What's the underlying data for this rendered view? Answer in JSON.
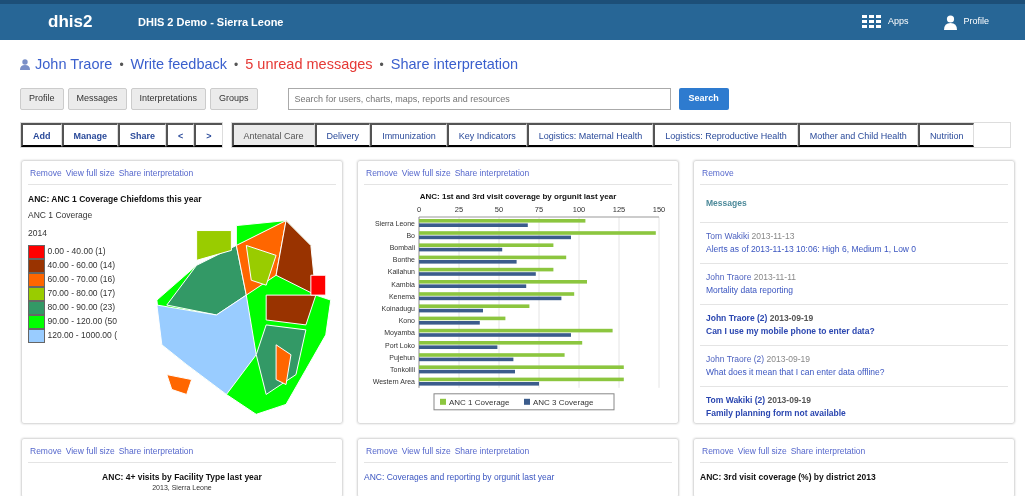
{
  "header": {
    "logo": "dhis2",
    "title": "DHIS 2 Demo - Sierra Leone",
    "apps": "Apps",
    "profile": "Profile"
  },
  "user_line": [
    {
      "text": "John Traore",
      "kind": "user"
    },
    {
      "text": "•",
      "kind": "sep"
    },
    {
      "text": "Write feedback",
      "kind": "link"
    },
    {
      "text": "•",
      "kind": "sep"
    },
    {
      "text": "5 unread messages",
      "kind": "alert"
    },
    {
      "text": "•",
      "kind": "sep"
    },
    {
      "text": "Share interpretation",
      "kind": "link"
    }
  ],
  "nav_buttons": [
    "Profile",
    "Messages",
    "Interpretations",
    "Groups"
  ],
  "search": {
    "placeholder": "Search for users, charts, maps, reports and resources",
    "button": "Search"
  },
  "actions": [
    "Add",
    "Manage",
    "Share",
    "<",
    ">"
  ],
  "dashboards": [
    {
      "label": "Antenatal Care",
      "selected": true
    },
    {
      "label": "Delivery",
      "selected": false
    },
    {
      "label": "Immunization",
      "selected": false
    },
    {
      "label": "Key Indicators",
      "selected": false
    },
    {
      "label": "Logistics: Maternal Health",
      "selected": false
    },
    {
      "label": "Logistics: Reproductive Health",
      "selected": false
    },
    {
      "label": "Mother and Child Health",
      "selected": false
    },
    {
      "label": "Nutrition",
      "selected": false
    }
  ],
  "map_card": {
    "links": [
      "Remove",
      "View full size",
      "Share interpretation"
    ],
    "title": "ANC: ANC 1 Coverage Chiefdoms this year",
    "legend_title": "ANC 1 Coverage",
    "legend_period": "2014",
    "legend": [
      {
        "label": "0.00 - 40.00 (1)",
        "color": "#ff0000"
      },
      {
        "label": "40.00 - 60.00 (14)",
        "color": "#993300"
      },
      {
        "label": "60.00 - 70.00 (16)",
        "color": "#ff6600"
      },
      {
        "label": "70.00 - 80.00 (17)",
        "color": "#99cc00"
      },
      {
        "label": "80.00 - 90.00 (23)",
        "color": "#339966"
      },
      {
        "label": "90.00 - 120.00 (50",
        "color": "#00ff00"
      },
      {
        "label": "120.00 - 1000.00 (",
        "color": "#99ccff"
      }
    ]
  },
  "chart_card": {
    "links": [
      "Remove",
      "View full size",
      "Share interpretation"
    ],
    "chart_data": {
      "type": "bar",
      "orientation": "horizontal",
      "title": "ANC: 1st and 3rd visit coverage by orgunit last year",
      "categories": [
        "Sierra Leone",
        "Bo",
        "Bombali",
        "Bonthe",
        "Kailahun",
        "Kambia",
        "Kenema",
        "Koinadugu",
        "Kono",
        "Moyamba",
        "Port Loko",
        "Pujehun",
        "Tonkolili",
        "Western Area"
      ],
      "xlim": [
        0,
        150
      ],
      "grid": true,
      "legend": true,
      "xticks": [
        0,
        25,
        50,
        75,
        100,
        125,
        150
      ],
      "series": [
        {
          "name": "ANC 1 Coverage",
          "color": "#8cc63f",
          "values": [
            104,
            148,
            84,
            92,
            84,
            105,
            97,
            69,
            54,
            121,
            102,
            91,
            128,
            128
          ]
        },
        {
          "name": "ANC 3 Coverage",
          "color": "#3b5c8c",
          "values": [
            68,
            95,
            52,
            61,
            73,
            67,
            89,
            40,
            38,
            95,
            49,
            59,
            60,
            75
          ]
        }
      ]
    }
  },
  "messages_card": {
    "links": [
      "Remove"
    ],
    "heading": "Messages",
    "items": [
      {
        "sender": "Tom Wakiki",
        "date": "2013-11-13",
        "subject": "Alerts as of 2013-11-13 10:06: High 6, Medium 1, Low 0",
        "unread": false
      },
      {
        "sender": "John Traore",
        "date": "2013-11-11",
        "subject": "Mortality data reporting",
        "unread": false
      },
      {
        "sender": "John Traore (2)",
        "date": "2013-09-19",
        "subject": "Can I use my mobile phone to enter data?",
        "unread": true
      },
      {
        "sender": "John Traore (2)",
        "date": "2013-09-19",
        "subject": "What does it mean that I can enter data offline?",
        "unread": false
      },
      {
        "sender": "Tom Wakiki (2)",
        "date": "2013-09-19",
        "subject": "Family planning form not available",
        "unread": true
      }
    ]
  },
  "bottom_cards": [
    {
      "links": [
        "Remove",
        "View full size",
        "Share interpretation"
      ],
      "title": "ANC: 4+ visits by Facility Type last year",
      "subtitle": "2013, Sierra Leone",
      "kind": "chart"
    },
    {
      "links": [
        "Remove",
        "View full size",
        "Share interpretation"
      ],
      "title": "ANC: Coverages and reporting by orgunit last year",
      "kind": "table"
    },
    {
      "links": [
        "Remove",
        "View full size",
        "Share interpretation"
      ],
      "title": "ANC: 3rd visit coverage (%) by district 2013",
      "kind": "map"
    }
  ]
}
